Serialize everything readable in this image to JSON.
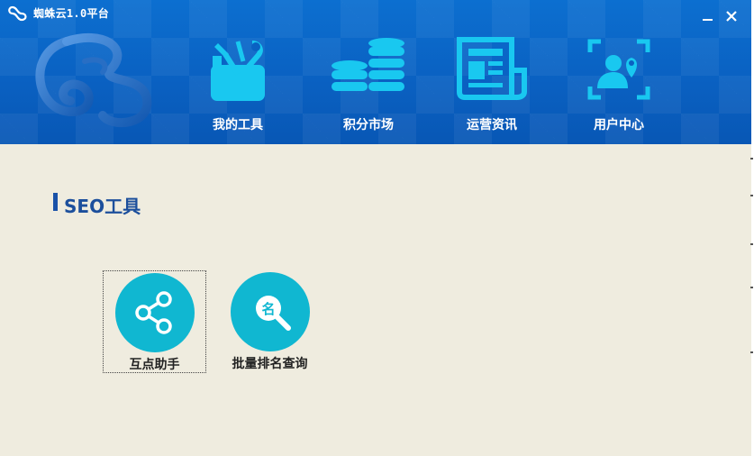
{
  "window": {
    "title": "蜘蛛云1.0平台"
  },
  "nav": {
    "items": [
      {
        "label": "我的工具",
        "icon": "toolbox-icon"
      },
      {
        "label": "积分市场",
        "icon": "coins-stack-icon"
      },
      {
        "label": "运营资讯",
        "icon": "newspaper-icon"
      },
      {
        "label": "用户中心",
        "icon": "user-location-icon"
      }
    ]
  },
  "section": {
    "title": "SEO工具"
  },
  "tools": [
    {
      "label": "互点助手",
      "icon": "share-icon"
    },
    {
      "label": "批量排名查询",
      "icon": "name-search-icon",
      "icon_text": "名"
    }
  ],
  "colors": {
    "header_blue": "#0a61c2",
    "icon_cyan": "#19c8f0",
    "tool_circle": "#10b7d1",
    "background": "#efecdf",
    "section_title": "#1c4f9c"
  }
}
